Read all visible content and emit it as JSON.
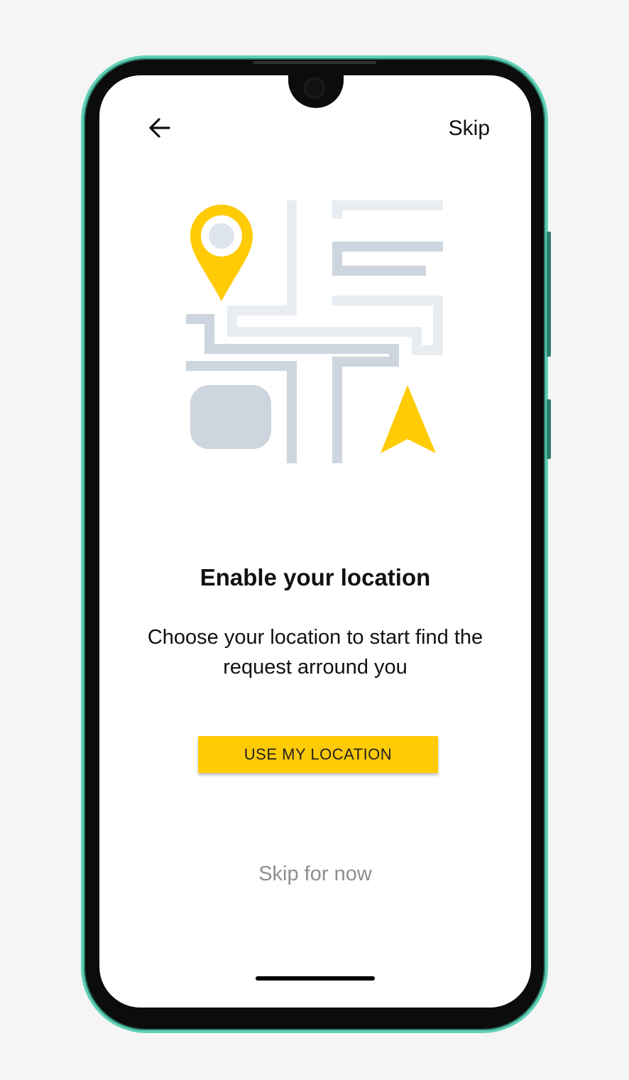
{
  "header": {
    "back_icon": "arrow-left-icon",
    "skip_label": "Skip"
  },
  "illustration": {
    "pin_icon": "location-pin-icon",
    "nav_icon": "navigation-arrow-icon",
    "accent_color": "#ffcb05",
    "road_dark": "#cdd5de",
    "road_light": "#e8edf2"
  },
  "main": {
    "title": "Enable your location",
    "subtitle": "Choose your location to start find the request arround you",
    "cta_label": "USE MY LOCATION",
    "skip_now_label": "Skip for now"
  },
  "device": {
    "frame_color": "#5fd0b6"
  }
}
